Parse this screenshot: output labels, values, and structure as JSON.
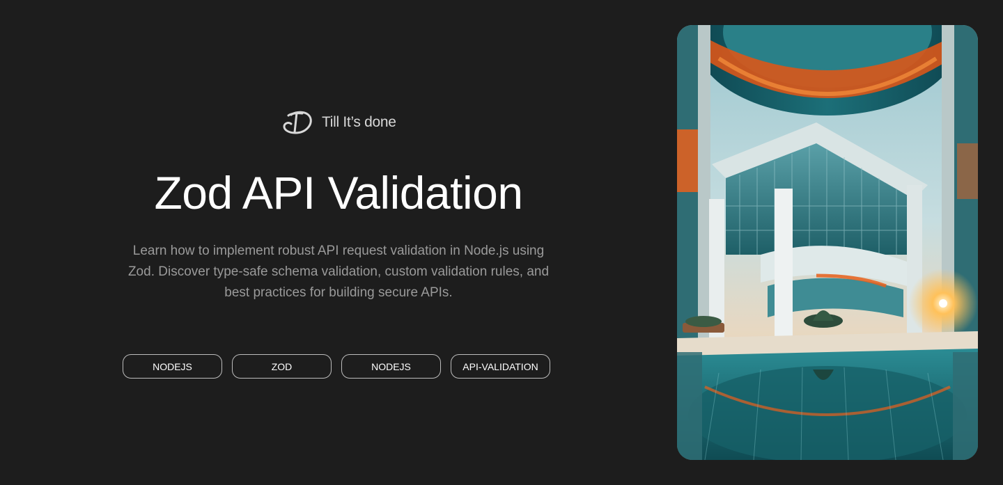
{
  "brand": {
    "name": "Till It’s done",
    "logo_icon": "td-monogram-icon"
  },
  "hero": {
    "title": "Zod API Validation",
    "description": "Learn how to implement robust API request validation in Node.js using Zod. Discover type-safe schema validation, custom validation rules, and best practices for building secure APIs.",
    "tags": [
      "NODEJS",
      "ZOD",
      "NODEJS",
      "API-VALIDATION"
    ]
  },
  "colors": {
    "background": "#1d1d1d",
    "title": "#ffffff",
    "description": "#9a9a9a",
    "tag_border": "#bdbdbd",
    "accent_orange": "#e8601c",
    "accent_teal": "#1f7f86"
  }
}
